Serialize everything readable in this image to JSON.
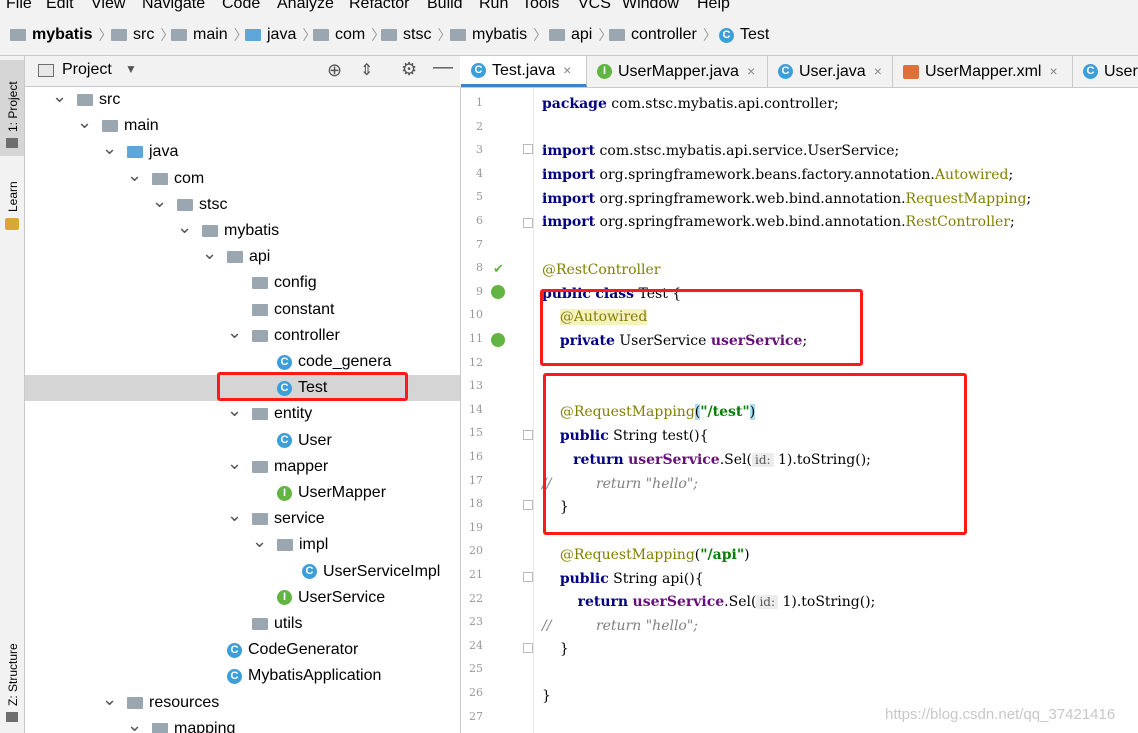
{
  "menu": [
    "File",
    "Edit",
    "View",
    "Navigate",
    "Code",
    "Analyze",
    "Refactor",
    "Build",
    "Run",
    "Tools",
    "VCS",
    "Window",
    "Help"
  ],
  "breadcrumb": [
    "mybatis",
    "src",
    "main",
    "java",
    "com",
    "stsc",
    "mybatis",
    "api",
    "controller",
    "Test"
  ],
  "left_strip": {
    "project": "1: Project",
    "learn": "Learn",
    "structure": "Z: Structure"
  },
  "project_panel": {
    "title": "Project"
  },
  "tree": [
    {
      "label": "src",
      "depth": 0,
      "kind": "folder",
      "expanded": true
    },
    {
      "label": "main",
      "depth": 1,
      "kind": "folder",
      "expanded": true
    },
    {
      "label": "java",
      "depth": 2,
      "kind": "folder-blue",
      "expanded": true
    },
    {
      "label": "com",
      "depth": 3,
      "kind": "package",
      "expanded": true
    },
    {
      "label": "stsc",
      "depth": 4,
      "kind": "package",
      "expanded": true
    },
    {
      "label": "mybatis",
      "depth": 5,
      "kind": "package",
      "expanded": true
    },
    {
      "label": "api",
      "depth": 6,
      "kind": "package",
      "expanded": true
    },
    {
      "label": "config",
      "depth": 7,
      "kind": "package",
      "expanded": false
    },
    {
      "label": "constant",
      "depth": 7,
      "kind": "package",
      "expanded": false
    },
    {
      "label": "controller",
      "depth": 7,
      "kind": "package",
      "expanded": true
    },
    {
      "label": "code_genera",
      "depth": 8,
      "kind": "class",
      "expanded": false
    },
    {
      "label": "Test",
      "depth": 8,
      "kind": "class",
      "expanded": false,
      "selected": true
    },
    {
      "label": "entity",
      "depth": 7,
      "kind": "package",
      "expanded": true
    },
    {
      "label": "User",
      "depth": 8,
      "kind": "class",
      "expanded": false
    },
    {
      "label": "mapper",
      "depth": 7,
      "kind": "package",
      "expanded": true
    },
    {
      "label": "UserMapper",
      "depth": 8,
      "kind": "interface",
      "expanded": false
    },
    {
      "label": "service",
      "depth": 7,
      "kind": "package",
      "expanded": true
    },
    {
      "label": "impl",
      "depth": 8,
      "kind": "package",
      "expanded": true
    },
    {
      "label": "UserServiceImpl",
      "depth": 9,
      "kind": "class",
      "expanded": false
    },
    {
      "label": "UserService",
      "depth": 8,
      "kind": "interface",
      "expanded": false
    },
    {
      "label": "utils",
      "depth": 7,
      "kind": "package",
      "expanded": false
    },
    {
      "label": "CodeGenerator",
      "depth": 6,
      "kind": "class",
      "expanded": false
    },
    {
      "label": "MybatisApplication",
      "depth": 6,
      "kind": "class",
      "expanded": false
    },
    {
      "label": "resources",
      "depth": 2,
      "kind": "folder-res",
      "expanded": true
    },
    {
      "label": "mapping",
      "depth": 3,
      "kind": "package",
      "expanded": true
    }
  ],
  "tabs": [
    {
      "label": "Test.java",
      "kind": "class",
      "active": true
    },
    {
      "label": "UserMapper.java",
      "kind": "interface",
      "active": false
    },
    {
      "label": "User.java",
      "kind": "class",
      "active": false
    },
    {
      "label": "UserMapper.xml",
      "kind": "xml",
      "active": false
    },
    {
      "label": "User",
      "kind": "class",
      "active": false
    }
  ],
  "line_numbers": [
    "1",
    "2",
    "3",
    "4",
    "5",
    "6",
    "7",
    "8",
    "9",
    "10",
    "11",
    "12",
    "13",
    "14",
    "15",
    "16",
    "17",
    "18",
    "19",
    "20",
    "21",
    "22",
    "23",
    "24",
    "25",
    "26",
    "27"
  ],
  "code": {
    "l1_kw": "package",
    "l1_rest": " com.stsc.mybatis.api.controller;",
    "import_kw": "import",
    "l3_rest": " com.stsc.mybatis.api.service.UserService;",
    "l4_a": " org.springframework.beans.factory.annotation.",
    "l4_b": "Autowired",
    "semi": ";",
    "l5_a": " org.springframework.web.bind.annotation.",
    "l5_b": "RequestMapping",
    "l6_a": " org.springframework.web.bind.annotation.",
    "l6_b": "RestController",
    "l8": "@RestController",
    "public_kw": "public",
    "class_kw": "class",
    "l9_rest": " Test {",
    "l10": "@Autowired",
    "private_kw": "private",
    "l11_type": " UserService ",
    "l11_field": "userService",
    "rm_ann": "@RequestMapping",
    "paren_open": "(",
    "paren_close": ")",
    "l14_str": "\"/test\"",
    "l15_rest": " String test(){",
    "return_kw": "return",
    "field": "userService",
    "sel": ".Sel(",
    "hint": "id:",
    "l16_tail": " 1).toString();",
    "comment_slashes": "//",
    "comment_body": "return \"hello\";",
    "close_brace": "}",
    "l20_str": "\"/api\"",
    "l21_rest": " String api(){"
  },
  "watermark": "https://blog.csdn.net/qq_37421416"
}
